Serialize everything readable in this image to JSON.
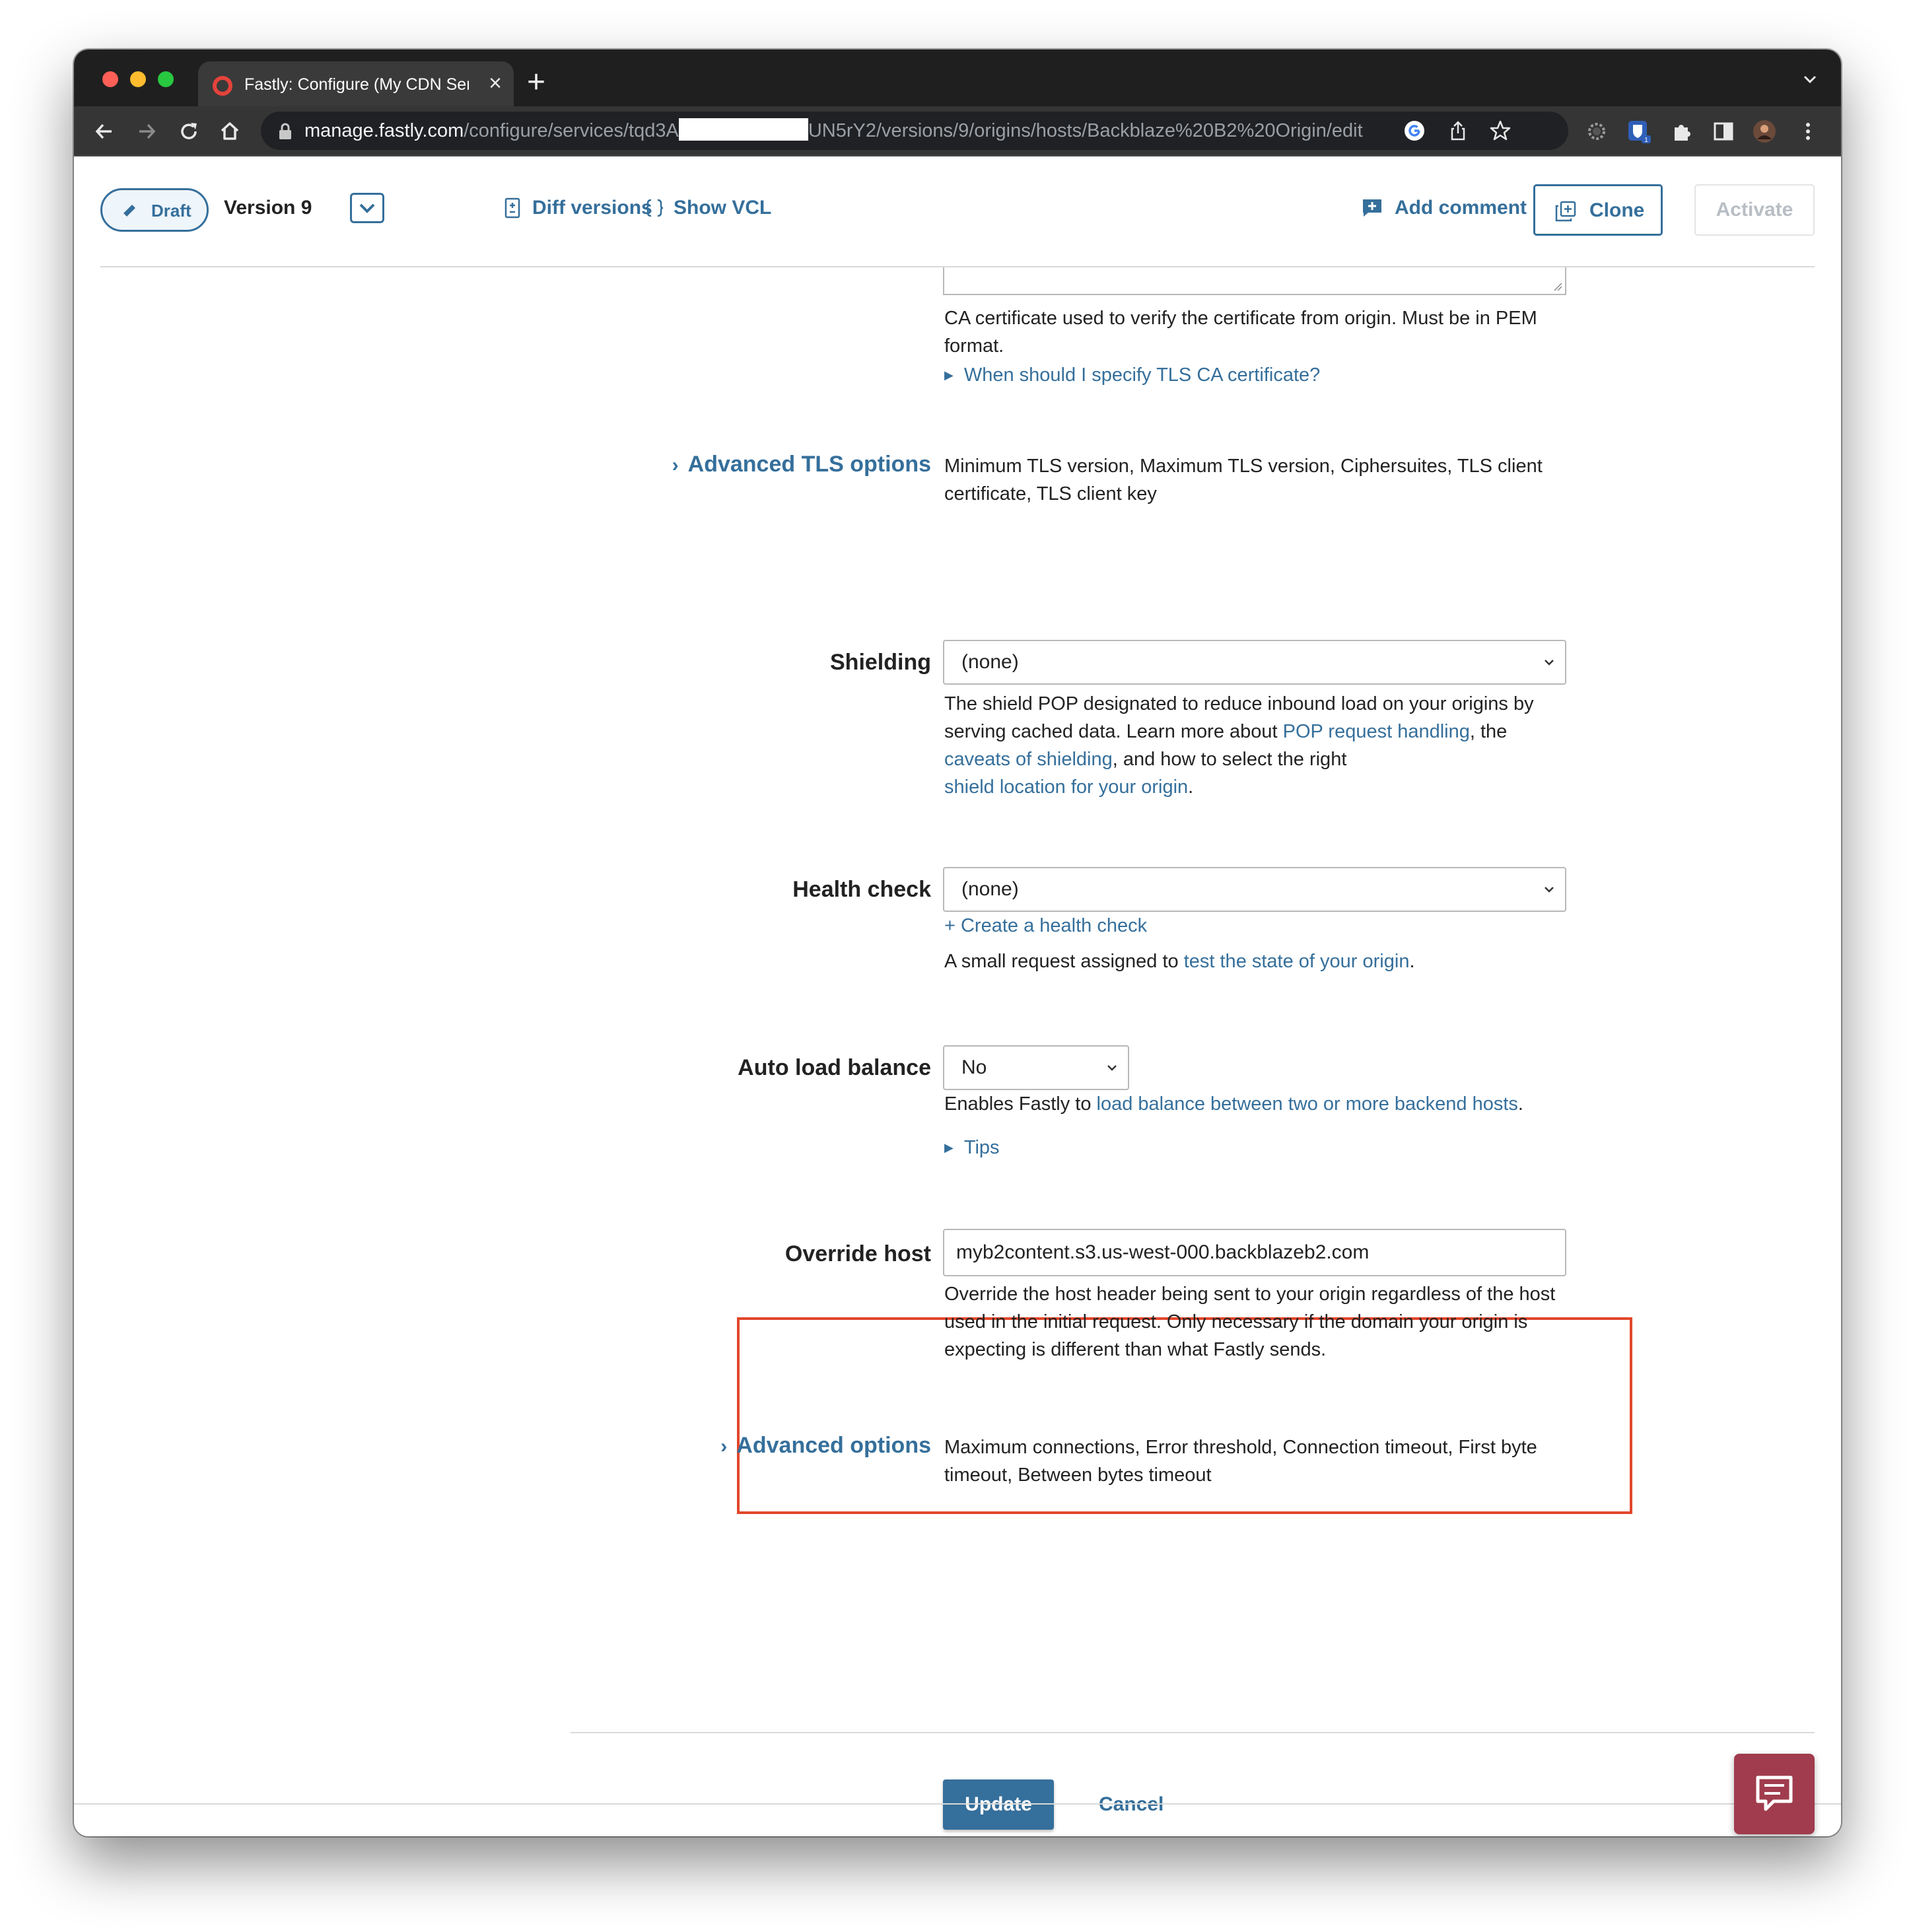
{
  "browser": {
    "tab_title": "Fastly: Configure (My CDN Service)",
    "tab_close": "×",
    "new_tab": "+",
    "url_host": "manage.fastly.com",
    "url_path_start": "/configure/services/tqd3A",
    "url_path_end": "UN5rY2/versions/9/origins/hosts/Backblaze%20B2%20Origin/edit"
  },
  "header": {
    "draft_label": "Draft",
    "version_label": "Version 9",
    "diff_versions": "Diff versions",
    "show_vcl": "Show VCL",
    "add_comment": "Add comment",
    "clone": "Clone",
    "activate": "Activate"
  },
  "tls_ca": {
    "help": "CA certificate used to verify the certificate from origin. Must be in PEM format.",
    "disclosure": "When should I specify TLS CA certificate?"
  },
  "advanced_tls": {
    "link": "Advanced TLS options",
    "summary": "Minimum TLS version, Maximum TLS version, Ciphersuites, TLS client certificate, TLS client key"
  },
  "shielding": {
    "label": "Shielding",
    "value": "(none)",
    "help_1": "The shield POP designated to reduce inbound load on your origins by serving cached data. Learn more about ",
    "link_1": "POP request handling",
    "help_2": ", the ",
    "link_2": "caveats of shielding",
    "help_3": ", and how to select the right ",
    "link_3": "shield location for your origin",
    "help_4": "."
  },
  "health_check": {
    "label": "Health check",
    "value": "(none)",
    "create_link": "+ Create a health check",
    "help_1": "A small request assigned to ",
    "link": "test the state of your origin",
    "help_2": "."
  },
  "auto_load_balance": {
    "label": "Auto load balance",
    "value": "No",
    "help_1": "Enables Fastly to ",
    "link": "load balance between two or more backend hosts",
    "help_2": ".",
    "tips": "Tips"
  },
  "override_host": {
    "label": "Override host",
    "value": "myb2content.s3.us-west-000.backblazeb2.com",
    "help": "Override the host header being sent to your origin regardless of the host used in the initial request. Only necessary if the domain your origin is expecting is different than what Fastly sends."
  },
  "advanced_options": {
    "link": "Advanced options",
    "summary": "Maximum connections, Error threshold, Connection timeout, First byte timeout, Between bytes timeout"
  },
  "actions": {
    "update": "Update",
    "cancel": "Cancel"
  },
  "colors": {
    "link": "#356f9b",
    "highlight": "#e2472c",
    "chat": "#a03c4e"
  },
  "icons": [
    "pencil-icon",
    "chevron-down-icon",
    "diff-icon",
    "braces-icon",
    "comment-icon",
    "clone-icon",
    "chat-icon"
  ]
}
